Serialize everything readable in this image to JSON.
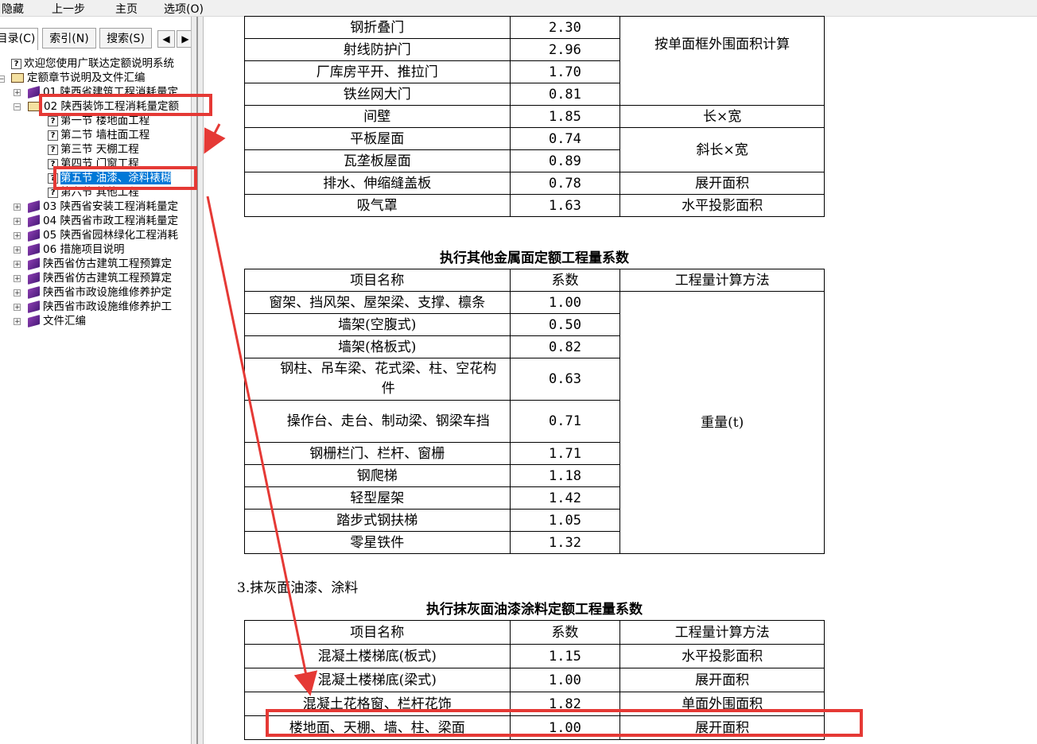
{
  "menu": {
    "hide": "隐藏",
    "back": "上一步",
    "home": "主页",
    "options": "选项(O)"
  },
  "tabs": {
    "contents": "目录(C)",
    "index": "索引(N)",
    "search": "搜索(S)"
  },
  "tree": [
    "欢迎您使用广联达定额说明系统",
    "定额章节说明及文件汇编",
    "01 陕西省建筑工程消耗量定",
    "02 陕西装饰工程消耗量定额",
    "第一节 楼地面工程",
    "第二节 墙柱面工程",
    "第三节 天棚工程",
    "第四节 门窗工程",
    "第五节 油漆、涂料裱糊",
    "第六节 其他工程",
    "03 陕西省安装工程消耗量定",
    "04 陕西省市政工程消耗量定",
    "05 陕西省园林绿化工程消耗",
    "06 措施项目说明",
    "陕西省仿古建筑工程预算定",
    "陕西省仿古建筑工程预算定",
    "陕西省市政设施维修养护定",
    "陕西省市政设施维修养护工",
    "文件汇编"
  ],
  "table1": {
    "rows": [
      {
        "name": "钢折叠门",
        "coef": "2.30"
      },
      {
        "name": "射线防护门",
        "coef": "2.96"
      },
      {
        "name": "厂库房平开、推拉门",
        "coef": "1.70"
      },
      {
        "name": "铁丝网大门",
        "coef": "0.81"
      },
      {
        "name": "间壁",
        "coef": "1.85"
      },
      {
        "name": "平板屋面",
        "coef": "0.74"
      },
      {
        "name": "瓦垄板屋面",
        "coef": "0.89"
      },
      {
        "name": "排水、伸缩缝盖板",
        "coef": "0.78"
      },
      {
        "name": "吸气罩",
        "coef": "1.63"
      }
    ],
    "methods": [
      "按单面框外围面积计算",
      "长×宽",
      "斜长×宽",
      "展开面积",
      "水平投影面积"
    ]
  },
  "table2": {
    "caption": "执行其他金属面定额工程量系数",
    "headers": [
      "项目名称",
      "系数",
      "工程量计算方法"
    ],
    "rows": [
      {
        "name": "窗架、挡风架、屋架梁、支撑、檩条",
        "coef": "1.00"
      },
      {
        "name": "墙架(空腹式)",
        "coef": "0.50"
      },
      {
        "name": "墙架(格板式)",
        "coef": "0.82"
      },
      {
        "name": "钢柱、吊车梁、花式梁、柱、空花构件",
        "coef": "0.63"
      },
      {
        "name": "操作台、走台、制动梁、钢梁车挡",
        "coef": "0.71"
      },
      {
        "name": "钢栅栏门、栏杆、窗栅",
        "coef": "1.71"
      },
      {
        "name": "钢爬梯",
        "coef": "1.18"
      },
      {
        "name": "轻型屋架",
        "coef": "1.42"
      },
      {
        "name": "踏步式钢扶梯",
        "coef": "1.05"
      },
      {
        "name": "零星铁件",
        "coef": "1.32"
      }
    ],
    "method": "重量(t)"
  },
  "section3": "3.抹灰面油漆、涂料",
  "table3": {
    "caption": "执行抹灰面油漆涂料定额工程量系数",
    "headers": [
      "项目名称",
      "系数",
      "工程量计算方法"
    ],
    "rows": [
      {
        "name": "混凝土楼梯底(板式)",
        "coef": "1.15",
        "method": "水平投影面积"
      },
      {
        "name": "混凝土楼梯底(梁式)",
        "coef": "1.00",
        "method": "展开面积"
      },
      {
        "name": "混凝土花格窗、栏杆花饰",
        "coef": "1.82",
        "method": "单面外围面积"
      },
      {
        "name": "楼地面、天棚、墙、柱、梁面",
        "coef": "1.00",
        "method": "展开面积"
      }
    ]
  },
  "colors": {
    "annotation": "#e53935",
    "selection": "#0078d7"
  }
}
